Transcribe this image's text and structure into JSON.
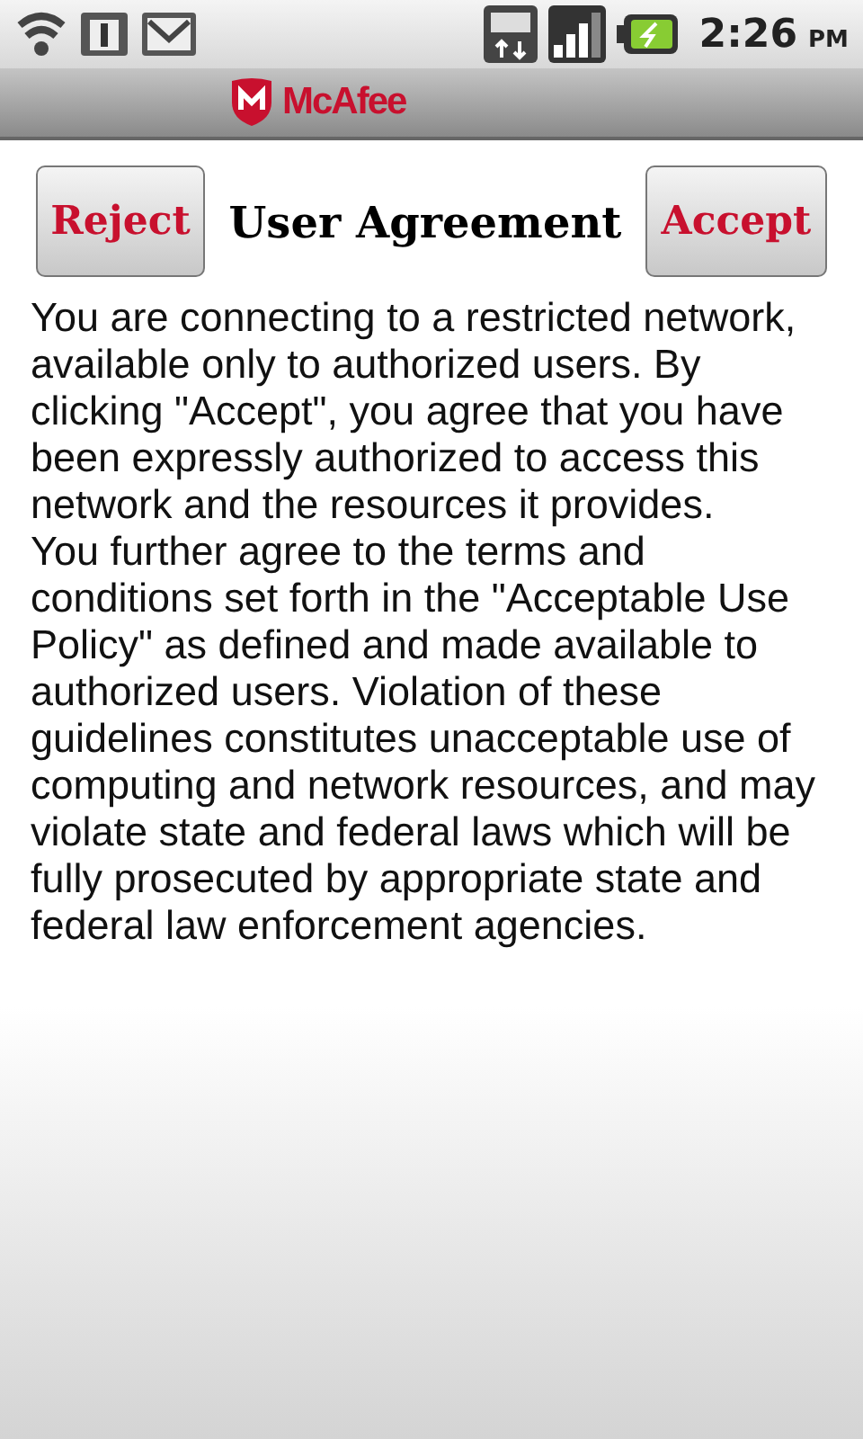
{
  "status_bar": {
    "time": "2:26",
    "ampm": "PM"
  },
  "header": {
    "logo": "McAfee"
  },
  "toolbar": {
    "reject": "Reject",
    "title": "User Agreement",
    "accept": "Accept"
  },
  "agreement": [
    "You are connecting to a restricted network, available only to authorized users.  By clicking \"Accept\", you agree that you have been expressly authorized to access this network and the resources it provides.",
    "You further agree to the terms and conditions set forth in the \"Acceptable Use Policy\" as defined and made available to authorized users.  Violation of these guidelines constitutes unacceptable use of computing and network resources, and may violate state and federal laws which will be fully prosecuted by appropriate state and federal law enforcement agencies."
  ]
}
